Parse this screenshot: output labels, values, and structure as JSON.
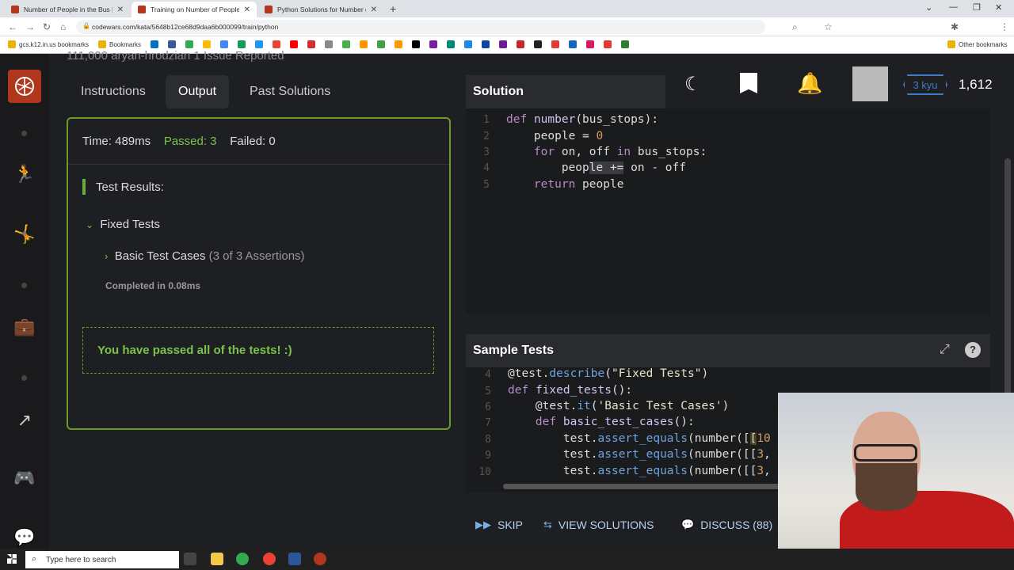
{
  "browser": {
    "tabs": [
      {
        "title": "Number of People in the Bus | C"
      },
      {
        "title": "Training on Number of People in"
      },
      {
        "title": "Python Solutions for Number of"
      }
    ],
    "url": "codewars.com/kata/5648b12ce68d9daa6b000099/train/python",
    "bookmarks": {
      "first": "gcs.k12.in.us bookmarks",
      "second": "Bookmarks",
      "other": "Other bookmarks"
    }
  },
  "topclip": "111,000    aryan-hrodzian    1 Issue Reported",
  "tabs": {
    "instructions": "Instructions",
    "output": "Output",
    "past": "Past Solutions"
  },
  "results": {
    "time": "Time: 489ms",
    "passed": "Passed: 3",
    "failed": "Failed: 0",
    "title": "Test Results:",
    "group": "Fixed Tests",
    "case": "Basic Test Cases",
    "assertions": "(3 of 3 Assertions)",
    "completed": "Completed in 0.08ms",
    "message": "You have passed all of the tests! :)"
  },
  "solution": {
    "header": "Solution"
  },
  "sample": {
    "header": "Sample Tests"
  },
  "user": {
    "rank": "3 kyu",
    "honor": "1,612"
  },
  "actions": {
    "skip": "SKIP",
    "view": "VIEW SOLUTIONS",
    "discuss": "DISCUSS (88)"
  },
  "taskbar": {
    "search": "Type here to search"
  }
}
